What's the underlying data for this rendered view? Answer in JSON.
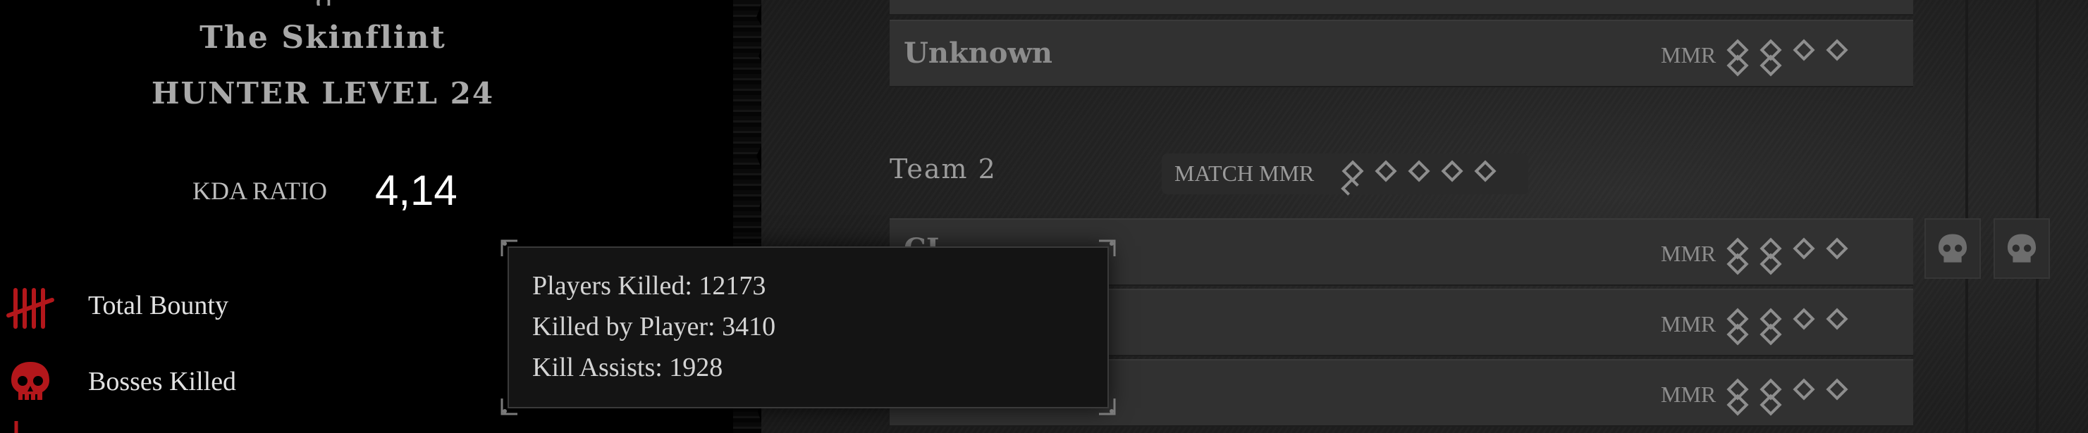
{
  "profile": {
    "name_partial": "g",
    "subtitle": "The Skinflint",
    "hunter_level": "HUNTER LEVEL 24",
    "kda_label": "KDA RATIO",
    "kda_value": "4,14"
  },
  "stats": [
    {
      "label": "Total Bounty",
      "icon": "tally-marks-icon"
    },
    {
      "label": "Bosses Killed",
      "icon": "skull-icon"
    }
  ],
  "tooltip": {
    "lines": [
      "Players Killed: 12173",
      "Killed by Player: 3410",
      "Kill Assists: 1928"
    ]
  },
  "team1": {
    "players": [
      {
        "name": "Unknown",
        "mmr_label": "MMR"
      }
    ]
  },
  "team2": {
    "label": "Team 2",
    "match_mmr_label": "MATCH MMR",
    "players": [
      {
        "name": "CL",
        "mmr_label": "MMR"
      },
      {
        "name": "",
        "mmr_label": "MMR"
      },
      {
        "name": "",
        "mmr_label": "MMR"
      }
    ]
  },
  "colors": {
    "accent_red": "#b3171b",
    "panel": "#313131",
    "background": "#000000"
  }
}
